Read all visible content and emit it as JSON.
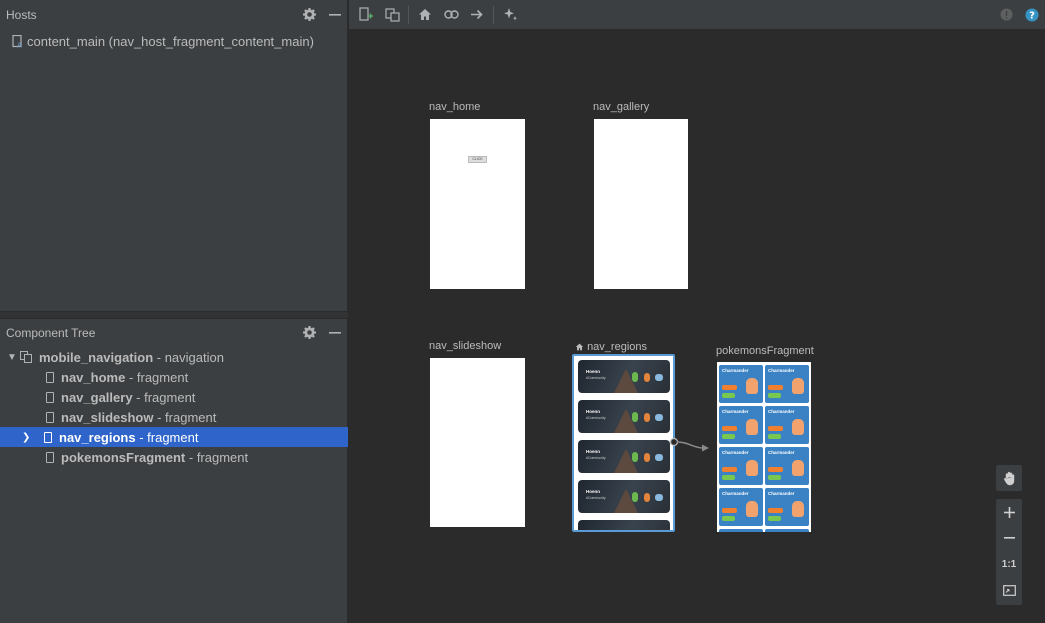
{
  "hosts_panel": {
    "title": "Hosts",
    "host_item": "content_main (nav_host_fragment_content_main)"
  },
  "component_tree": {
    "title": "Component Tree",
    "root": {
      "name": "mobile_navigation",
      "type": "- navigation"
    },
    "items": [
      {
        "name": "nav_home",
        "type": "- fragment"
      },
      {
        "name": "nav_gallery",
        "type": "- fragment"
      },
      {
        "name": "nav_slideshow",
        "type": "- fragment"
      },
      {
        "name": "nav_regions",
        "type": "- fragment"
      },
      {
        "name": "pokemonsFragment",
        "type": "- fragment"
      }
    ]
  },
  "canvas": {
    "destinations": {
      "home": {
        "label": "nav_home",
        "button_text": "CLICK"
      },
      "gallery": {
        "label": "nav_gallery"
      },
      "slideshow": {
        "label": "nav_slideshow"
      },
      "regions": {
        "label": "nav_regions",
        "card_title": "Hoenn",
        "card_sub": "#Community"
      },
      "pokemons": {
        "label": "pokemonsFragment",
        "card_title": "Charmander"
      }
    }
  },
  "zoom_tools": {
    "fit_label": "1:1"
  },
  "colors": {
    "selection": "#2f65ca",
    "selected_destination_border": "#5a9bd6",
    "pokemon_card": "#3b82c4",
    "help": "#3592c4"
  }
}
